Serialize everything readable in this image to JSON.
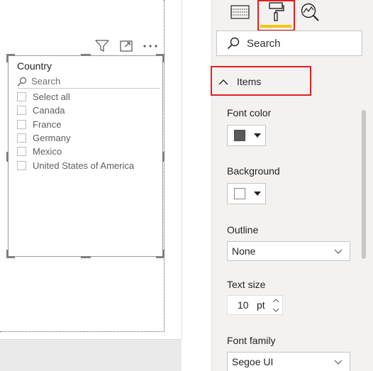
{
  "slicer": {
    "title": "Country",
    "search_placeholder": "Search",
    "items": [
      {
        "label": "Select all"
      },
      {
        "label": "Canada"
      },
      {
        "label": "France"
      },
      {
        "label": "Germany"
      },
      {
        "label": "Mexico"
      },
      {
        "label": "United States of America"
      }
    ]
  },
  "visual_header": {
    "icons": [
      "filter-icon",
      "focus-mode-icon",
      "more-options-icon"
    ]
  },
  "format_pane": {
    "tabs": [
      {
        "name": "fields",
        "icon": "fields-icon"
      },
      {
        "name": "format",
        "icon": "paint-roller-icon",
        "active": true
      },
      {
        "name": "analytics",
        "icon": "analytics-icon"
      }
    ],
    "search_placeholder": "Search",
    "section": {
      "title": "Items",
      "expanded": true,
      "font_color_label": "Font color",
      "font_color_value": "#5b5b5b",
      "background_label": "Background",
      "background_value": "#ffffff",
      "outline_label": "Outline",
      "outline_value": "None",
      "text_size_label": "Text size",
      "text_size_value": "10",
      "text_size_unit": "pt",
      "font_family_label": "Font family",
      "font_family_value": "Segoe UI"
    }
  },
  "colors": {
    "accent_underline": "#f2c811",
    "highlight_box": "#e0201f"
  }
}
